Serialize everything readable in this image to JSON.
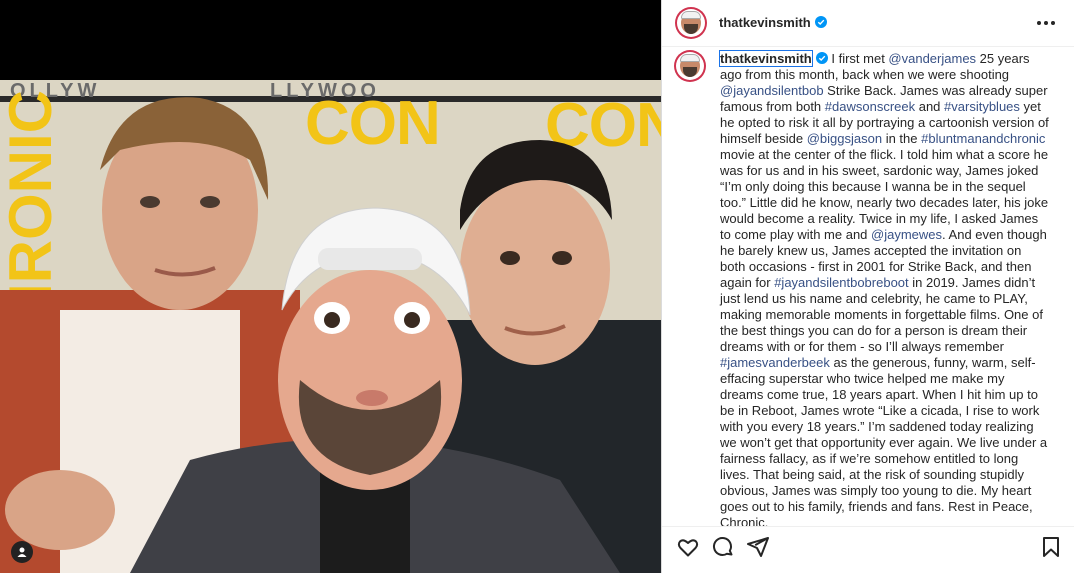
{
  "post": {
    "username": "thatkevinsmith",
    "verified": true,
    "caption": {
      "segments": [
        {
          "type": "user",
          "text": "thatkevinsmith"
        },
        {
          "type": "text",
          "text": " I first met "
        },
        {
          "type": "link",
          "text": "@vanderjames"
        },
        {
          "type": "text",
          "text": " 25 years ago from this month, back when we were shooting "
        },
        {
          "type": "link",
          "text": "@jayandsilentbob"
        },
        {
          "type": "text",
          "text": " Strike Back. James was already super famous from both "
        },
        {
          "type": "link",
          "text": "#dawsonscreek"
        },
        {
          "type": "text",
          "text": " and "
        },
        {
          "type": "link",
          "text": "#varsityblues"
        },
        {
          "type": "text",
          "text": " yet he opted to risk it all by portraying a cartoonish version of himself beside "
        },
        {
          "type": "link",
          "text": "@biggsjason"
        },
        {
          "type": "text",
          "text": " in the "
        },
        {
          "type": "link",
          "text": "#bluntmanandchronic"
        },
        {
          "type": "text",
          "text": " movie at the center of the flick. I told him what a score he was for us and in his sweet, sardonic way, James joked “I’m only doing this because I wanna be in the sequel too.” Little did he know, nearly two decades later, his joke would become a reality. Twice in my life, I asked James to come play with me and "
        },
        {
          "type": "link",
          "text": "@jaymewes"
        },
        {
          "type": "text",
          "text": ". And even though he barely knew us, James accepted the invitation on both occasions - first in 2001 for Strike Back, and then again for "
        },
        {
          "type": "link",
          "text": "#jayandsilentbobreboot"
        },
        {
          "type": "text",
          "text": " in 2019. James didn’t just lend us his name and celebrity, he came to PLAY, making memorable moments in forgettable films. One of the best things you can do for a person is dream their dreams with or for them - so I’ll always remember "
        },
        {
          "type": "link",
          "text": "#jamesvanderbeek"
        },
        {
          "type": "text",
          "text": " as the generous, funny, warm, self-effacing superstar who twice helped me make my dreams come true, 18 years apart. When I hit him up to be in Reboot, James wrote “Like a cicada, I rise to work with you every 18 years.” I’m saddened today realizing we won’t get that opportunity ever again. We live under a fairness fallacy, as if we’re somehow entitled to long lives. That being said, at the risk of sounding stupidly obvious, James was simply too young to die. My heart goes out to his family, friends and fans. Rest in Peace, Chronic."
        }
      ]
    },
    "photo": {
      "banner_texts": [
        "OLLYW",
        "LLYWOO",
        "CON",
        "CON",
        "CHRONIC"
      ]
    }
  },
  "icons": {
    "more": "more-horizontal-icon",
    "like": "heart-icon",
    "comment": "comment-icon",
    "share": "send-icon",
    "save": "bookmark-icon",
    "user_tag": "user-tag-icon",
    "verified": "verified-badge-icon"
  },
  "colors": {
    "link": "#385185",
    "verified": "#0095f6",
    "accent_yellow": "#f2c417"
  }
}
